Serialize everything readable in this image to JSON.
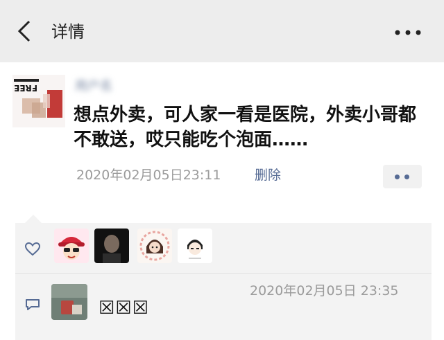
{
  "header": {
    "title": "详情",
    "back_icon": "chevron-left-icon",
    "more_icon": "more-dots-icon"
  },
  "post": {
    "avatar_text": "FREE",
    "username": "用户名",
    "text": "想点外卖，可人家一看是医院，外卖小哥都不敢送，哎只能吃个泡面……",
    "timestamp": "2020年02月05日23:11",
    "delete_label": "删除",
    "action_icon": "two-dots-icon"
  },
  "likes": {
    "icon": "heart-outline-icon",
    "count": 4
  },
  "comment": {
    "icon": "comment-bubble-icon",
    "timestamp": "2020年02月05日 23:35",
    "text": "☒☒☒"
  },
  "colors": {
    "header_bg": "#ededed",
    "link": "#566b94",
    "meta_gray": "#9b9b9b",
    "feedback_bg": "#f3f3f3"
  }
}
